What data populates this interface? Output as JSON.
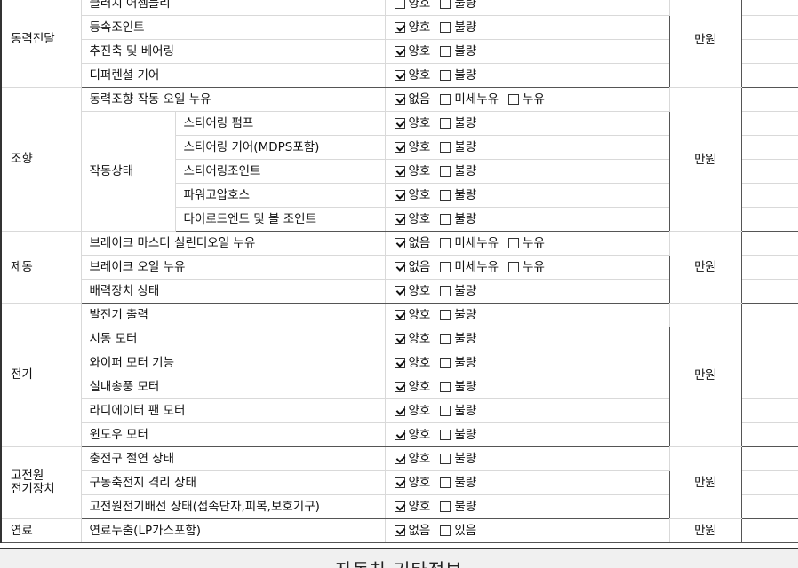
{
  "price_unit": "만원",
  "groups": [
    {
      "category": "동력전달",
      "rows": [
        {
          "item": "클러치 어셈블리",
          "options": [
            {
              "label": "양호",
              "checked": false
            },
            {
              "label": "불량",
              "checked": false
            }
          ]
        },
        {
          "item": "등속조인트",
          "options": [
            {
              "label": "양호",
              "checked": true
            },
            {
              "label": "불량",
              "checked": false
            }
          ]
        },
        {
          "item": "추진축 및 베어링",
          "options": [
            {
              "label": "양호",
              "checked": true
            },
            {
              "label": "불량",
              "checked": false
            }
          ]
        },
        {
          "item": "디퍼렌셜 기어",
          "options": [
            {
              "label": "양호",
              "checked": true
            },
            {
              "label": "불량",
              "checked": false
            }
          ]
        }
      ]
    },
    {
      "category": "조향",
      "rows": [
        {
          "item": "동력조향 작동 오일 누유",
          "options": [
            {
              "label": "없음",
              "checked": true
            },
            {
              "label": "미세누유",
              "checked": false
            },
            {
              "label": "누유",
              "checked": false
            }
          ]
        },
        {
          "parent": "작동상태",
          "item": "스티어링 펌프",
          "options": [
            {
              "label": "양호",
              "checked": true
            },
            {
              "label": "불량",
              "checked": false
            }
          ]
        },
        {
          "parent": "작동상태",
          "item": "스티어링 기어(MDPS포함)",
          "options": [
            {
              "label": "양호",
              "checked": true
            },
            {
              "label": "불량",
              "checked": false
            }
          ]
        },
        {
          "parent": "작동상태",
          "item": "스티어링조인트",
          "options": [
            {
              "label": "양호",
              "checked": true
            },
            {
              "label": "불량",
              "checked": false
            }
          ]
        },
        {
          "parent": "작동상태",
          "item": "파워고압호스",
          "options": [
            {
              "label": "양호",
              "checked": true
            },
            {
              "label": "불량",
              "checked": false
            }
          ]
        },
        {
          "parent": "작동상태",
          "item": "타이로드엔드 및 볼 조인트",
          "options": [
            {
              "label": "양호",
              "checked": true
            },
            {
              "label": "불량",
              "checked": false
            }
          ]
        }
      ]
    },
    {
      "category": "제동",
      "rows": [
        {
          "item": "브레이크 마스터 실린더오일 누유",
          "options": [
            {
              "label": "없음",
              "checked": true
            },
            {
              "label": "미세누유",
              "checked": false
            },
            {
              "label": "누유",
              "checked": false
            }
          ]
        },
        {
          "item": "브레이크 오일 누유",
          "options": [
            {
              "label": "없음",
              "checked": true
            },
            {
              "label": "미세누유",
              "checked": false
            },
            {
              "label": "누유",
              "checked": false
            }
          ]
        },
        {
          "item": "배력장치 상태",
          "options": [
            {
              "label": "양호",
              "checked": true
            },
            {
              "label": "불량",
              "checked": false
            }
          ]
        }
      ]
    },
    {
      "category": "전기",
      "rows": [
        {
          "item": "발전기 출력",
          "options": [
            {
              "label": "양호",
              "checked": true
            },
            {
              "label": "불량",
              "checked": false
            }
          ]
        },
        {
          "item": "시동 모터",
          "options": [
            {
              "label": "양호",
              "checked": true
            },
            {
              "label": "불량",
              "checked": false
            }
          ]
        },
        {
          "item": "와이퍼 모터 기능",
          "options": [
            {
              "label": "양호",
              "checked": true
            },
            {
              "label": "불량",
              "checked": false
            }
          ]
        },
        {
          "item": "실내송풍 모터",
          "options": [
            {
              "label": "양호",
              "checked": true
            },
            {
              "label": "불량",
              "checked": false
            }
          ]
        },
        {
          "item": "라디에이터 팬 모터",
          "options": [
            {
              "label": "양호",
              "checked": true
            },
            {
              "label": "불량",
              "checked": false
            }
          ]
        },
        {
          "item": "윈도우 모터",
          "options": [
            {
              "label": "양호",
              "checked": true
            },
            {
              "label": "불량",
              "checked": false
            }
          ]
        }
      ]
    },
    {
      "category": "고전원\n전기장치",
      "rows": [
        {
          "item": "충전구 절연 상태",
          "options": [
            {
              "label": "양호",
              "checked": true
            },
            {
              "label": "불량",
              "checked": false
            }
          ]
        },
        {
          "item": "구동축전지 격리 상태",
          "options": [
            {
              "label": "양호",
              "checked": true
            },
            {
              "label": "불량",
              "checked": false
            }
          ]
        },
        {
          "item": "고전원전기배선 상태(접속단자,피복,보호기구)",
          "options": [
            {
              "label": "양호",
              "checked": true
            },
            {
              "label": "불량",
              "checked": false
            }
          ]
        }
      ]
    },
    {
      "category": "연료",
      "rows": [
        {
          "item": "연료누출(LP가스포함)",
          "options": [
            {
              "label": "없음",
              "checked": true
            },
            {
              "label": "있음",
              "checked": false
            }
          ]
        }
      ]
    }
  ],
  "footer": {
    "title": "자동차 기타정보"
  }
}
